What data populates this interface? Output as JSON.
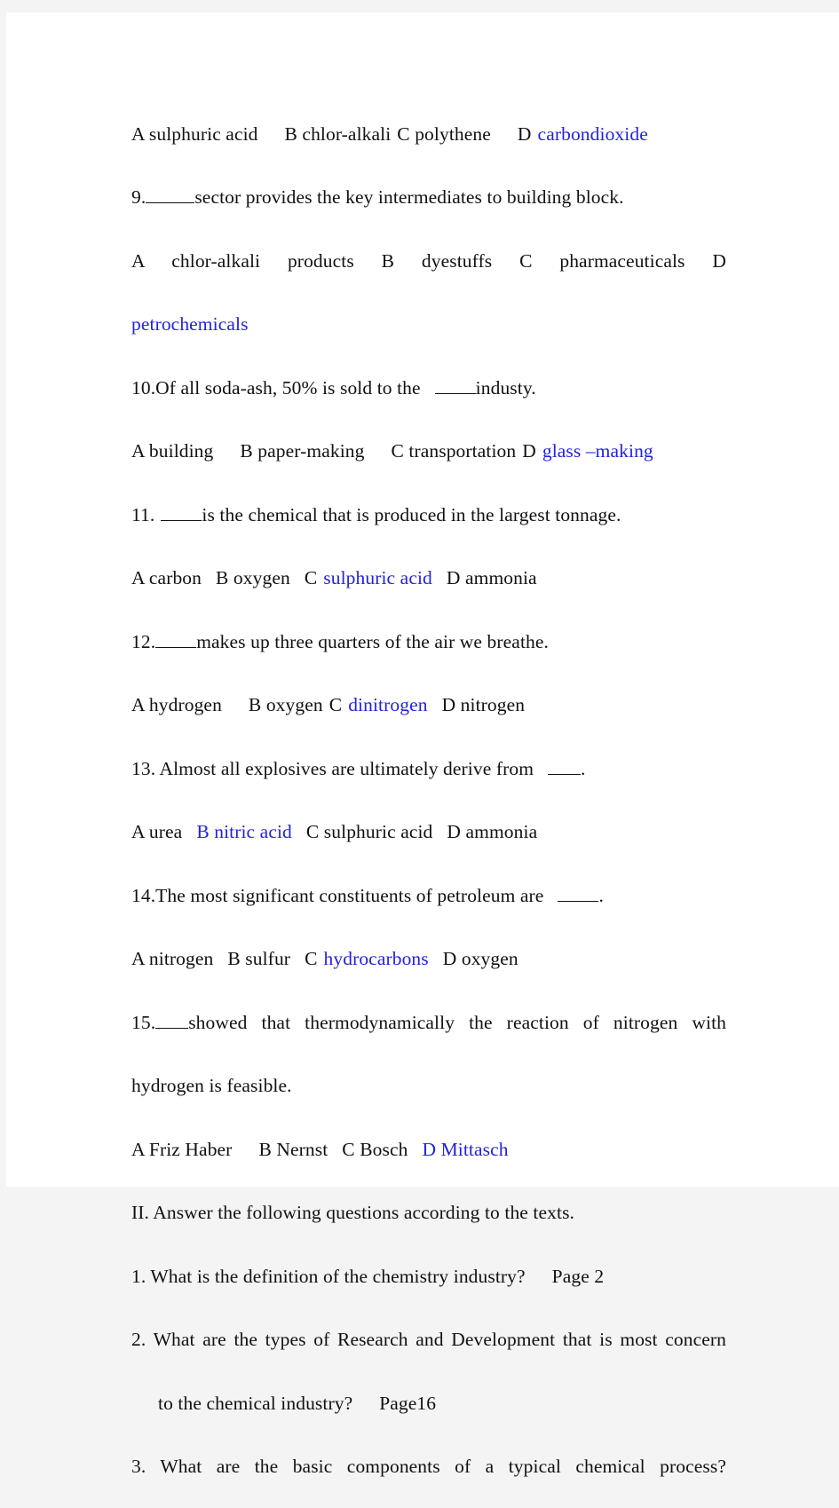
{
  "document": {
    "type": "exam-paper",
    "page_background": "#ffffff",
    "canvas_background": "#f4f4f4",
    "answer_color": "#2222dd",
    "text_color": "#111111"
  },
  "lines": {
    "q8_options": {
      "optA": "A  sulphuric  acid",
      "optB": "B  chlor-alkali",
      "optC": "C  polythene",
      "optD_letter": "D",
      "optD_answer": "carbondioxide"
    },
    "q9": {
      "number": "9.",
      "text_after_blank": "sector  provides  the  key  intermediates  to  building  block.",
      "optA": "A    chlor-alkali    products",
      "optB": "B    dyestuffs",
      "optC": "C    pharmaceuticals",
      "optD_letter": "D",
      "optD_answer": "petrochemicals"
    },
    "q10": {
      "stem_before_blank": "10.Of  all  soda-ash,  50%  is  sold  to  the",
      "stem_after_blank": "industy.",
      "optA": "A building",
      "optB": "B paper-making",
      "optC": "C transportation",
      "optD_letter": "D",
      "optD_answer": "glass –making"
    },
    "q11": {
      "number": "11.",
      "text_after_blank": "is  the  chemical  that  is  produced  in  the  largest  tonnage.",
      "optA": "A carbon",
      "optB": "B oxygen",
      "optC_letter": "C",
      "optC_answer": "sulphuric acid",
      "optD": "D ammonia"
    },
    "q12": {
      "number": "12.",
      "text_after_blank": "makes  up  three  quarters  of  the  air  we  breathe.",
      "optA": "A hydrogen",
      "optB": "B oxygen",
      "optC_letter": "C",
      "optC_answer": "dinitrogen",
      "optD": "D nitrogen"
    },
    "q13": {
      "stem_before_blank": "13.  Almost  all  explosives  are  ultimately  derive  from",
      "stem_after_blank": ".",
      "optA": "A urea",
      "optB_answer": "B nitric acid",
      "optC": "C sulphuric acid",
      "optD": "D ammonia"
    },
    "q14": {
      "stem_before_blank": "14.The  most  significant  constituents  of  petroleum  are",
      "stem_after_blank": ".",
      "optA": "A nitrogen",
      "optB": "B sulfur",
      "optC_letter": "C",
      "optC_answer": "hydrocarbons",
      "optD": "D oxygen"
    },
    "q15": {
      "number": "15.",
      "text_after_blank": "showed  that  thermodynamically  the  reaction  of  nitrogen  with",
      "text_line2": "hydrogen  is  feasible.",
      "optA": "A Friz Haber",
      "optB": "B Nernst",
      "optC": "C Bosch",
      "optD_answer": "D Mittasch"
    },
    "section2_heading": "II.  Answer  the  following  questions  according  to  the  texts.",
    "s2q1": {
      "text": "1.  What  is  the  definition  of  the  chemistry  industry?",
      "page_ref": "Page  2"
    },
    "s2q2": {
      "text_line1": "2.  What  are  the  types  of  Research  and  Development  that  is  most  concern",
      "text_line2": "to  the  chemical  industry?",
      "page_ref": "Page16"
    },
    "s2q3": {
      "text": "3.  What  are  the  basic  components  of  a  typical  chemical  process?"
    }
  }
}
